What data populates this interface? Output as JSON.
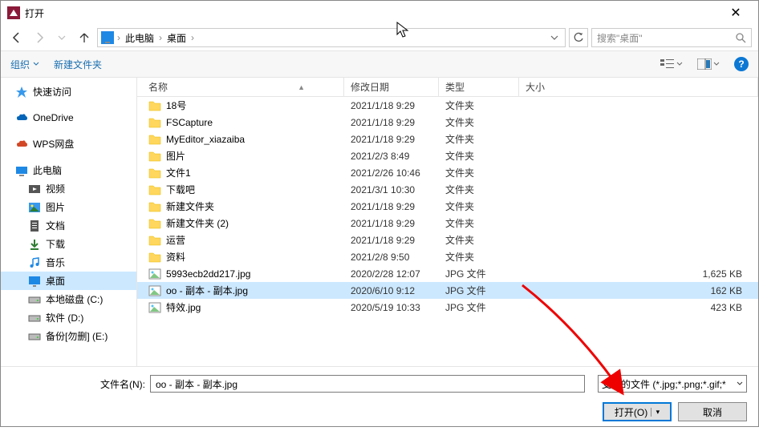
{
  "title": "打开",
  "breadcrumb": {
    "seg1": "此电脑",
    "seg2": "桌面"
  },
  "search_placeholder": "搜索\"桌面\"",
  "toolbar": {
    "organize": "组织",
    "newfolder": "新建文件夹"
  },
  "columns": {
    "name": "名称",
    "date": "修改日期",
    "type": "类型",
    "size": "大小"
  },
  "sidebar": {
    "quick": "快速访问",
    "onedrive": "OneDrive",
    "wps": "WPS网盘",
    "thispc": "此电脑",
    "videos": "视频",
    "pictures": "图片",
    "documents": "文档",
    "downloads": "下载",
    "music": "音乐",
    "desktop": "桌面",
    "diskc": "本地磁盘 (C:)",
    "diskd": "软件 (D:)",
    "diske": "备份[勿删] (E:)"
  },
  "files": [
    {
      "name": "18号",
      "date": "2021/1/18 9:29",
      "type": "文件夹",
      "size": "",
      "icon": "folder"
    },
    {
      "name": "FSCapture",
      "date": "2021/1/18 9:29",
      "type": "文件夹",
      "size": "",
      "icon": "folder"
    },
    {
      "name": "MyEditor_xiazaiba",
      "date": "2021/1/18 9:29",
      "type": "文件夹",
      "size": "",
      "icon": "folder"
    },
    {
      "name": "图片",
      "date": "2021/2/3 8:49",
      "type": "文件夹",
      "size": "",
      "icon": "folder"
    },
    {
      "name": "文件1",
      "date": "2021/2/26 10:46",
      "type": "文件夹",
      "size": "",
      "icon": "folder"
    },
    {
      "name": "下载吧",
      "date": "2021/3/1 10:30",
      "type": "文件夹",
      "size": "",
      "icon": "folder"
    },
    {
      "name": "新建文件夹",
      "date": "2021/1/18 9:29",
      "type": "文件夹",
      "size": "",
      "icon": "folder"
    },
    {
      "name": "新建文件夹 (2)",
      "date": "2021/1/18 9:29",
      "type": "文件夹",
      "size": "",
      "icon": "folder"
    },
    {
      "name": "运营",
      "date": "2021/1/18 9:29",
      "type": "文件夹",
      "size": "",
      "icon": "folder"
    },
    {
      "name": "资料",
      "date": "2021/2/8 9:50",
      "type": "文件夹",
      "size": "",
      "icon": "folder"
    },
    {
      "name": "5993ecb2dd217.jpg",
      "date": "2020/2/28 12:07",
      "type": "JPG 文件",
      "size": "1,625 KB",
      "icon": "image"
    },
    {
      "name": "oo - 副本 - 副本.jpg",
      "date": "2020/6/10 9:12",
      "type": "JPG 文件",
      "size": "162 KB",
      "icon": "image",
      "selected": true
    },
    {
      "name": "特效.jpg",
      "date": "2020/5/19 10:33",
      "type": "JPG 文件",
      "size": "423 KB",
      "icon": "image"
    }
  ],
  "footer": {
    "filename_label": "文件名(N):",
    "filename_value": "oo - 副本 - 副本.jpg",
    "filter": "支持的文件 (*.jpg;*.png;*.gif;*",
    "open": "打开(O)",
    "cancel": "取消"
  }
}
